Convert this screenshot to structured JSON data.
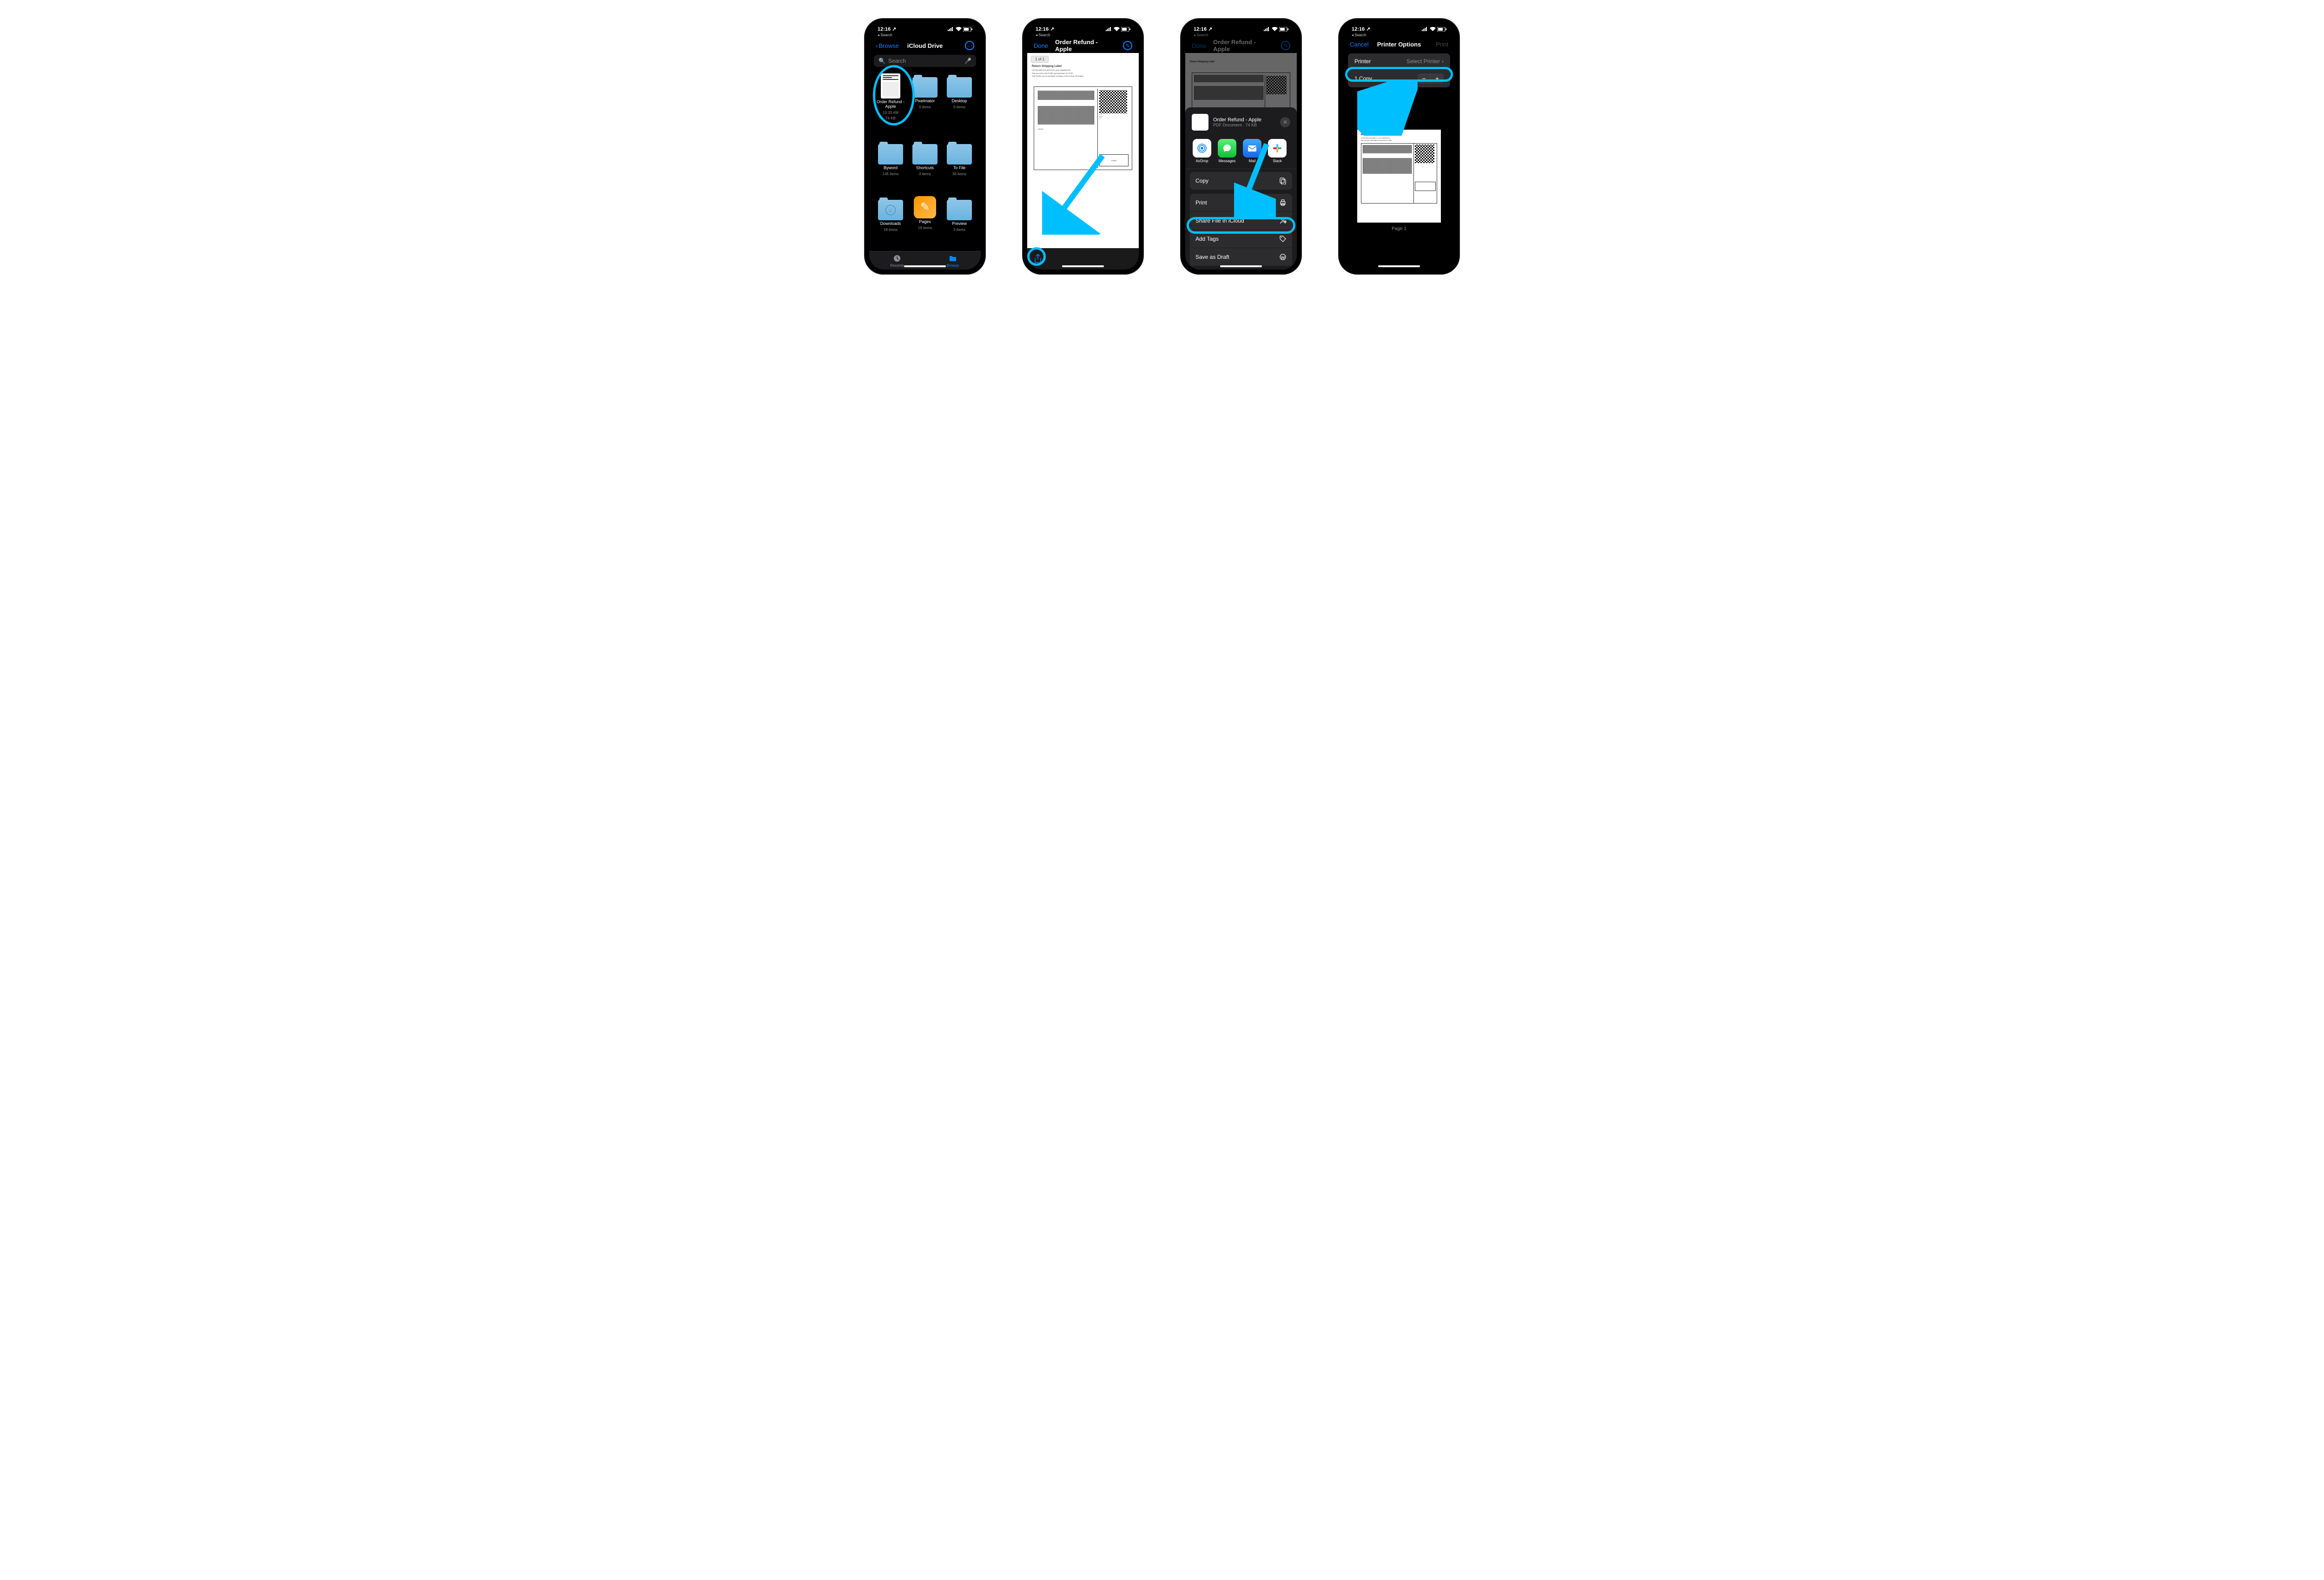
{
  "status": {
    "time": "12:16",
    "breadcrumb": "Search"
  },
  "screen1": {
    "back": "Browse",
    "title": "iCloud Drive",
    "search_placeholder": "Search",
    "files": [
      {
        "name": "Order Refund - Apple",
        "line2": "10:33 AM",
        "line3": "74 KB",
        "type": "doc"
      },
      {
        "name": "Pixelmator",
        "line2": "0 items",
        "type": "folder"
      },
      {
        "name": "Desktop",
        "line2": "0 items",
        "type": "folder"
      },
      {
        "name": "Byword",
        "line2": "145 items",
        "type": "folder"
      },
      {
        "name": "Shortcuts",
        "line2": "0 items",
        "type": "folder"
      },
      {
        "name": "To File",
        "line2": "36 items",
        "type": "folder"
      },
      {
        "name": "Downloads",
        "line2": "18 items",
        "type": "folder-dl"
      },
      {
        "name": "Pages",
        "line2": "19 items",
        "type": "pages"
      },
      {
        "name": "Preview",
        "line2": "3 items",
        "type": "folder"
      }
    ],
    "tabs": {
      "recents": "Recents",
      "browse": "Browse"
    }
  },
  "screen2": {
    "done": "Done",
    "title": "Order Refund - Apple",
    "page_indicator": "1 of 1",
    "doc_heading": "Return Shipping Label",
    "doc_bullets": [
      "Cut this label and attach it to your shipping box.",
      "Ship your item with FedEx by December 03, 2020.",
      "Visit FedEx.com to schedule a pickup or find a drop-off location."
    ]
  },
  "screen3": {
    "done": "Done",
    "title": "Order Refund - Apple",
    "share_title": "Order Refund - Apple",
    "share_sub": "PDF Document · 74 KB",
    "apps": [
      {
        "label": "AirDrop",
        "bg": "#fff",
        "icon": "airdrop"
      },
      {
        "label": "Messages",
        "bg": "#30d158",
        "icon": "message"
      },
      {
        "label": "Mail",
        "bg": "#1e90ff",
        "icon": "mail"
      },
      {
        "label": "Slack",
        "bg": "#fff",
        "icon": "slack"
      }
    ],
    "actions": {
      "copy": "Copy",
      "print": "Print",
      "share_icloud": "Share File in iCloud",
      "add_tags": "Add Tags",
      "save_draft": "Save as Draft"
    }
  },
  "screen4": {
    "cancel": "Cancel",
    "title": "Printer Options",
    "print": "Print",
    "printer_label": "Printer",
    "printer_value": "Select Printer",
    "copies": "1 Copy",
    "page_label": "Page 1"
  }
}
